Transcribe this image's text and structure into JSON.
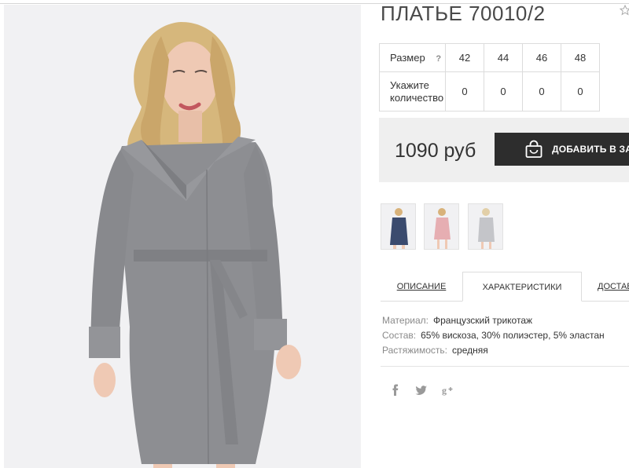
{
  "product": {
    "title": "ПЛАТЬЕ 70010/2",
    "image_alt": "woman in grey wrap dress with belt"
  },
  "size_table": {
    "size_label": "Размер",
    "help_icon_text": "?",
    "sizes": [
      "42",
      "44",
      "46",
      "48"
    ],
    "quantity_label": "Укажите количество",
    "quantities": [
      "0",
      "0",
      "0",
      "0"
    ]
  },
  "purchase": {
    "price": "1090 руб",
    "add_to_cart_label": "ДОБАВИТЬ В ЗАКАЗ"
  },
  "thumbnails": [
    {
      "name": "navy dress",
      "color": "#3b4b6e"
    },
    {
      "name": "pink dress",
      "color": "#e6aeb2"
    },
    {
      "name": "grey dress",
      "color": "#c4c5c9"
    }
  ],
  "tabs": [
    {
      "label": "ОПИСАНИЕ",
      "active": false
    },
    {
      "label": "ХАРАКТЕРИСТИКИ",
      "active": true
    },
    {
      "label": "ДОСТАВКА",
      "active": false
    }
  ],
  "specs": [
    {
      "key": "Материал:",
      "value": "Французский трикотаж"
    },
    {
      "key": "Состав:",
      "value": "65% вискоза, 30% полиэстер, 5% эластан"
    },
    {
      "key": "Растяжимость:",
      "value": "средняя"
    }
  ],
  "social": [
    {
      "icon": "facebook-icon",
      "glyph": "f"
    },
    {
      "icon": "twitter-icon",
      "glyph": "🐦"
    },
    {
      "icon": "google-plus-icon",
      "glyph": "g+"
    }
  ],
  "colors": {
    "button_dark": "#2d2d2d",
    "price_bg": "#efefef",
    "border": "#dcdcdc",
    "muted_text": "#8a8a8a"
  }
}
